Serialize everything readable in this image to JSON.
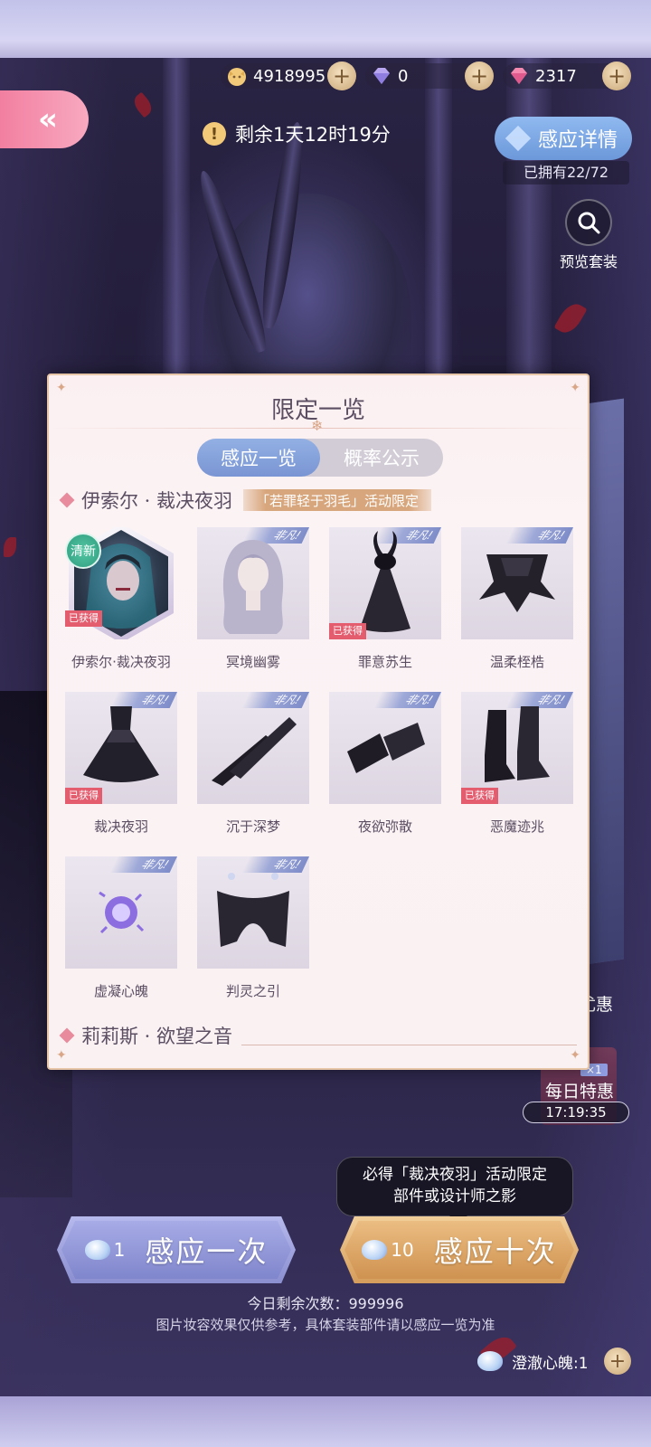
{
  "currency": {
    "gold": "4918995",
    "diamond": "0",
    "crystal": "2317"
  },
  "timer": {
    "text": "剩余1天12时19分"
  },
  "header": {
    "detail_label": "感应详情",
    "owned_text": "已拥有22/72",
    "preview_label": "预览套装"
  },
  "modal": {
    "title": "限定一览",
    "tabs": [
      {
        "label": "感应一览",
        "active": true
      },
      {
        "label": "概率公示",
        "active": false
      }
    ],
    "section1": {
      "title": "伊索尔 · 裁决夜羽",
      "tag": "「若罪轻于羽毛」活动限定"
    },
    "section2": {
      "title": "莉莉斯 · 欲望之音"
    },
    "badges": {
      "owned": "已获得",
      "fresh": "清新",
      "ribbon": "非凡!"
    },
    "items": [
      {
        "name": "伊索尔·裁决夜羽",
        "owned": true,
        "fresh": true
      },
      {
        "name": "冥境幽雾",
        "owned": false
      },
      {
        "name": "罪意苏生",
        "owned": true
      },
      {
        "name": "温柔桎梏",
        "owned": false
      },
      {
        "name": "裁决夜羽",
        "owned": true
      },
      {
        "name": "沉于深梦",
        "owned": false
      },
      {
        "name": "夜欲弥散",
        "owned": false
      },
      {
        "name": "恶魔迹兆",
        "owned": true
      },
      {
        "name": "虚凝心魄",
        "owned": false
      },
      {
        "name": "判灵之引",
        "owned": false
      }
    ]
  },
  "side": {
    "benefit_partial": "尤惠",
    "daily_multiplier": "×1",
    "daily_label": "每日特惠",
    "daily_time": "17:19:35"
  },
  "draw": {
    "bubble_line1": "必得「裁决夜羽」活动限定",
    "bubble_line2": "部件或设计师之影",
    "one_count": "1",
    "one_label": "感应一次",
    "ten_count": "10",
    "ten_label": "感应十次"
  },
  "footer": {
    "remaining": "今日剩余次数：999996",
    "disclaimer": "图片妆容效果仅供参考，具体套装部件请以感应一览为准",
    "soul": "澄澈心魄:1"
  },
  "colors": {
    "accent_pink": "#f27fa0",
    "accent_blue": "#7a95d3",
    "accent_gold": "#d59d5b",
    "owned_badge": "#e45d6f"
  }
}
